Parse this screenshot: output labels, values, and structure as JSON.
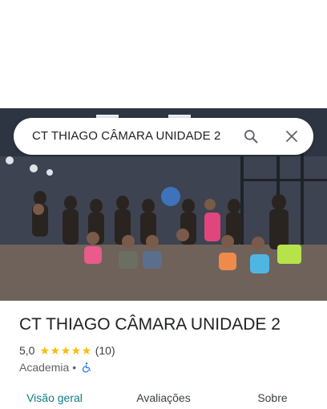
{
  "search": {
    "query": "CT THIAGO CÂMARA UNIDADE 2"
  },
  "place": {
    "name": "CT THIAGO CÂMARA UNIDADE 2",
    "rating": "5,0",
    "stars": "★★★★★",
    "review_count": "(10)",
    "category": "Academia",
    "separator": "•",
    "accessibility_icon": "wheelchair-icon"
  },
  "tabs": [
    {
      "label": "Visão geral",
      "active": true
    },
    {
      "label": "Avaliações",
      "active": false
    },
    {
      "label": "Sobre",
      "active": false
    }
  ],
  "colors": {
    "accent": "#0b7d83",
    "star": "#fbbc04",
    "accessibility": "#1a73e8"
  }
}
